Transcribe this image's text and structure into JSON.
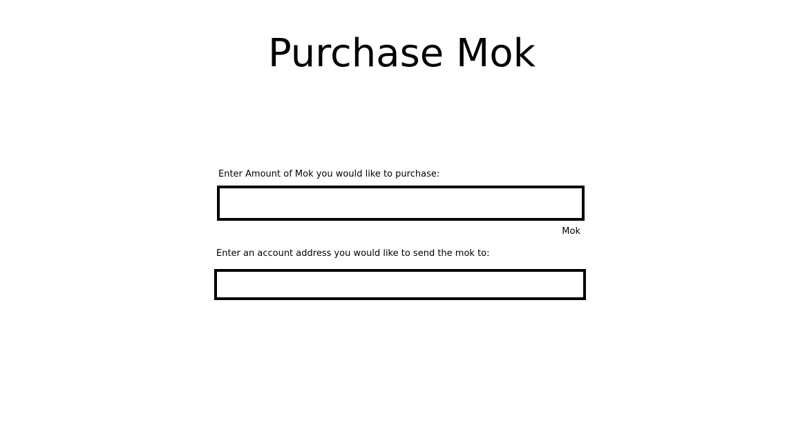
{
  "page": {
    "title": "Purchase Mok"
  },
  "form": {
    "amount": {
      "label": "Enter Amount of Mok you would like to purchase:",
      "value": "",
      "unit": "Mok"
    },
    "address": {
      "label": "Enter an account address you would like to send the mok to:",
      "value": ""
    }
  }
}
